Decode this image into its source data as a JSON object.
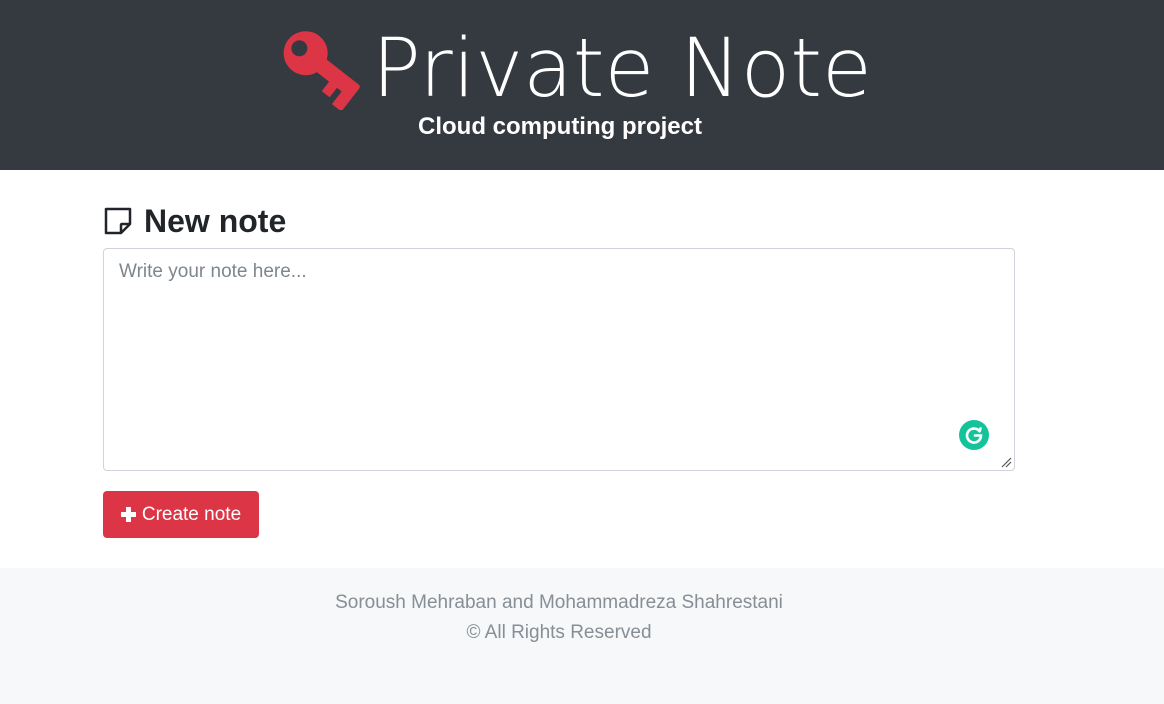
{
  "header": {
    "title": "Private Note",
    "subtitle": "Cloud computing project",
    "logo_icon": "key-icon",
    "logo_color": "#dc3545",
    "background": "#343a40"
  },
  "main": {
    "heading": "New note",
    "heading_icon": "sticky-note-icon",
    "note_input": {
      "value": "",
      "placeholder": "Write your note here..."
    },
    "grammarly_icon": "grammarly-icon",
    "grammarly_color": "#15c39a",
    "create_button": {
      "label": "Create note",
      "icon": "plus-icon",
      "color": "#dc3545"
    }
  },
  "footer": {
    "authors": "Soroush Mehraban and Mohammadreza Shahrestani",
    "rights": "© All Rights Reserved"
  }
}
